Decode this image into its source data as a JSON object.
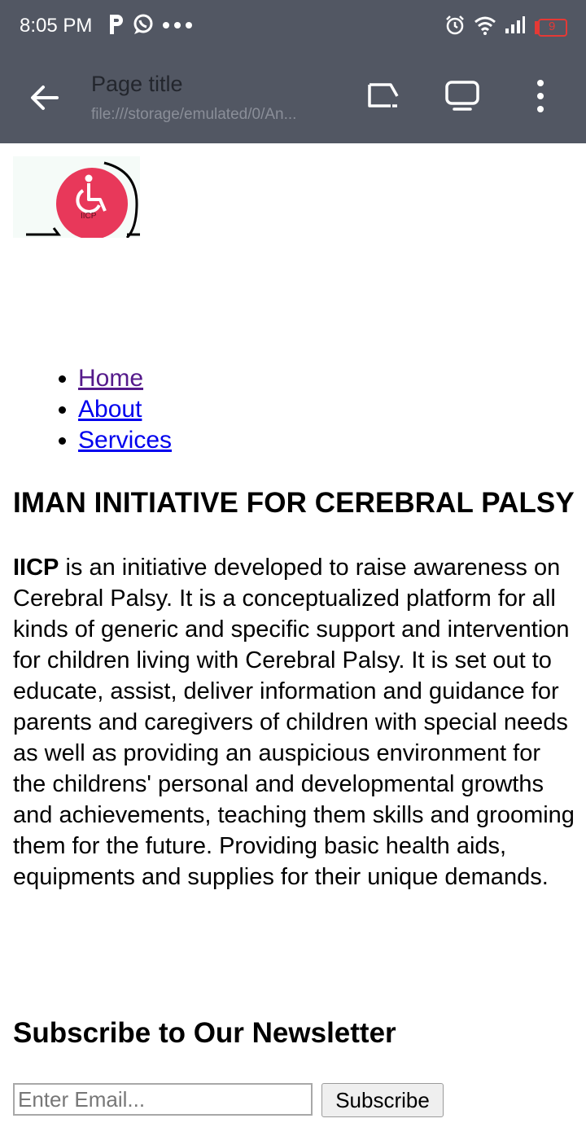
{
  "status_bar": {
    "time": "8:05 PM",
    "battery_level": "9",
    "icons": [
      "p-notification-icon",
      "whatsapp-icon",
      "more-notifications-icon",
      "alarm-icon",
      "wifi-icon",
      "signal-icon",
      "battery-low-icon"
    ]
  },
  "toolbar": {
    "title": "Page title",
    "url": "file:///storage/emulated/0/An...",
    "icons": [
      "back-arrow-icon",
      "cast-icon",
      "desktop-mode-icon",
      "overflow-menu-icon"
    ]
  },
  "page": {
    "logo_text": "IICP",
    "nav": [
      {
        "label": "Home",
        "visited": true
      },
      {
        "label": "About",
        "visited": false
      },
      {
        "label": "Services",
        "visited": false
      }
    ],
    "org_title": "IMAN INITIATIVE FOR CEREBRAL PALSY",
    "about_bold": "IICP",
    "about_text": " is an initiative developed to raise awareness on Cerebral Palsy. It is a conceptualized platform for all kinds of generic and specific support and intervention for children living with Cerebral Palsy. It is set out to educate, assist, deliver information and guidance for parents and caregivers of children with special needs as well as providing an auspicious environment for the childrens' personal and developmental growths and achievements, teaching them skills and grooming them for the future. Providing basic health aids, equipments and supplies for their unique demands.",
    "newsletter_title": "Subscribe to Our Newsletter",
    "email_placeholder": "Enter Email...",
    "subscribe_label": "Subscribe"
  },
  "colors": {
    "chrome": "#525763",
    "logo_red": "#e8385a",
    "battery_red": "#e53935",
    "link": "#0000ee",
    "visited_link": "#551a8b"
  }
}
